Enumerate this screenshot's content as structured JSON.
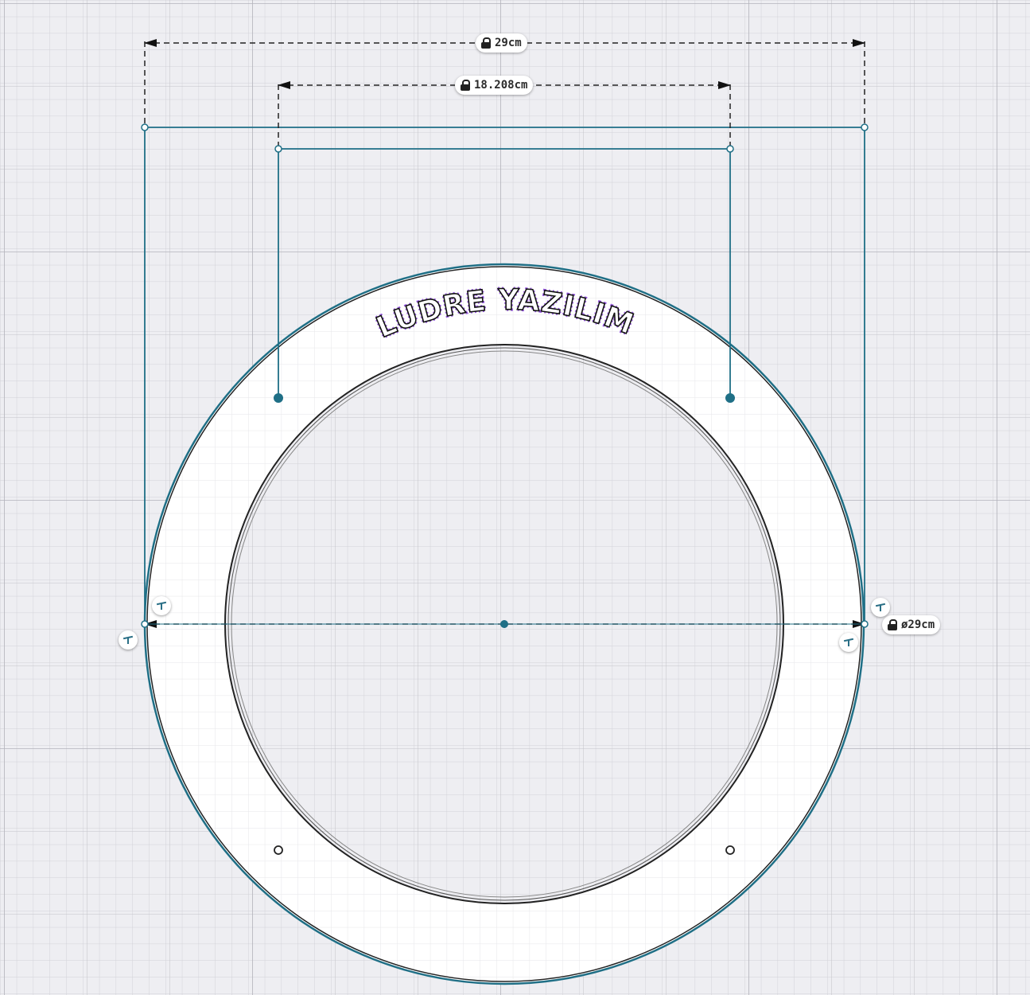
{
  "colors": {
    "background": "#eeeef2",
    "grid_minor": "#d4d4da",
    "grid_major": "#b9b9c1",
    "construction": "#1f6f86",
    "outline": "#222222",
    "text_highlight": "#9b5de5"
  },
  "dimensions": {
    "outer_width": {
      "value": "29cm",
      "locked": true
    },
    "inner_width": {
      "value": "18.208cm",
      "locked": true
    },
    "diameter": {
      "value": "ø29cm",
      "locked": true
    }
  },
  "ring_text": "LUDRE YAZILIM",
  "icons": {
    "lock": "lock-icon",
    "snap": "snap-handle-icon"
  }
}
